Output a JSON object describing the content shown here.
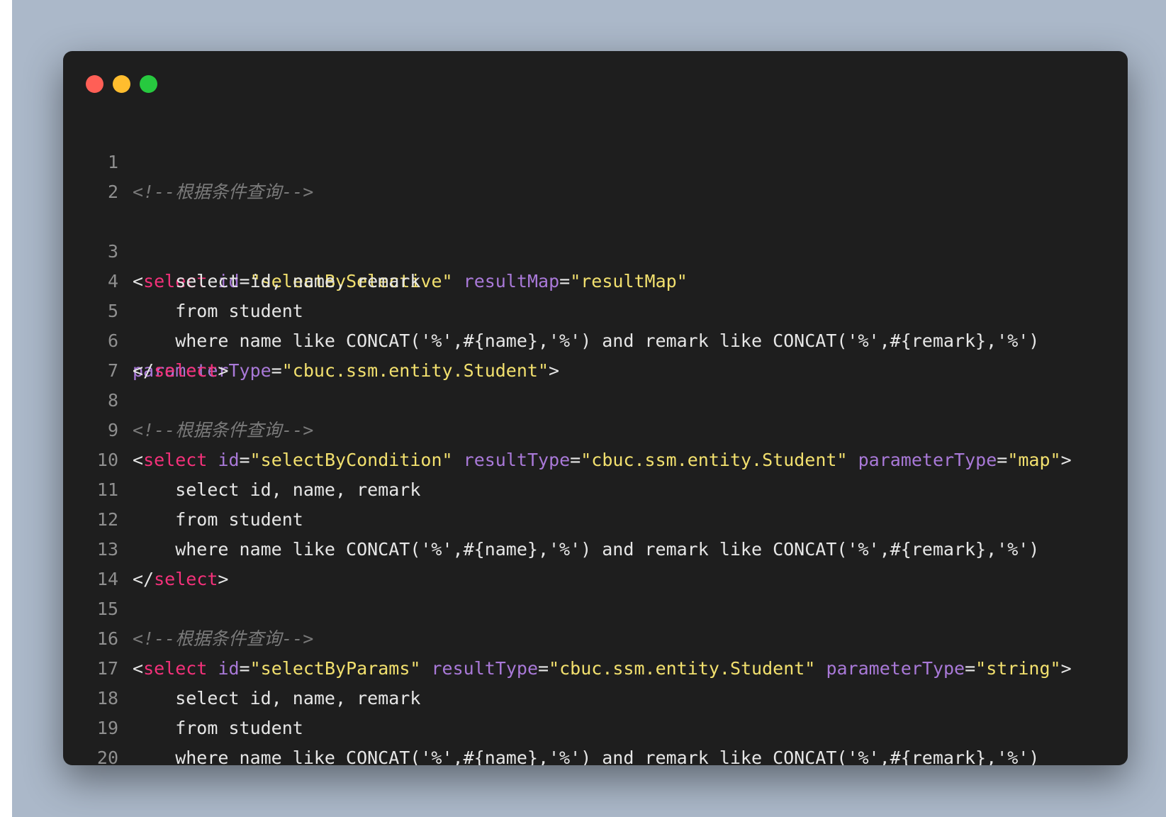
{
  "window": {
    "controls": {
      "close": "#ff5f56",
      "minimize": "#ffbd2e",
      "maximize": "#27c93f"
    }
  },
  "colors": {
    "background": "#abb8c9",
    "editor": "#1e1e1e",
    "tag": "#f4317a",
    "attribute": "#a979d8",
    "string": "#f2e06e",
    "comment": "#7a7a7a",
    "text": "#e6e6e6",
    "line_number": "#8f8f8f"
  },
  "code": {
    "comment": "<!--根据条件查询-->",
    "open_lt": "<",
    "close_open": "</",
    "gt": ">",
    "tag_name": "select",
    "eq": "=",
    "attr_id": "id",
    "attr_resultMap": "resultMap",
    "attr_resultType": "resultType",
    "attr_parameterType": "parameterType",
    "val_selectBySelective": "\"selectBySelective\"",
    "val_resultMap": "\"resultMap\"",
    "val_entity": "\"cbuc.ssm.entity.Student\"",
    "val_selectByCondition": "\"selectByCondition\"",
    "val_map": "\"map\"",
    "val_selectByParams": "\"selectByParams\"",
    "val_string": "\"string\"",
    "sql_select": "    select id, name, remark",
    "sql_from": "    from student",
    "sql_where": "    where name like CONCAT('%',#{name},'%') and remark like CONCAT('%',#{remark},'%')",
    "line_numbers": [
      "1",
      "2",
      "3",
      "4",
      "5",
      "6",
      "7",
      "8",
      "9",
      "10",
      "11",
      "12",
      "13",
      "14",
      "15",
      "16",
      "17",
      "18",
      "19",
      "20"
    ]
  }
}
